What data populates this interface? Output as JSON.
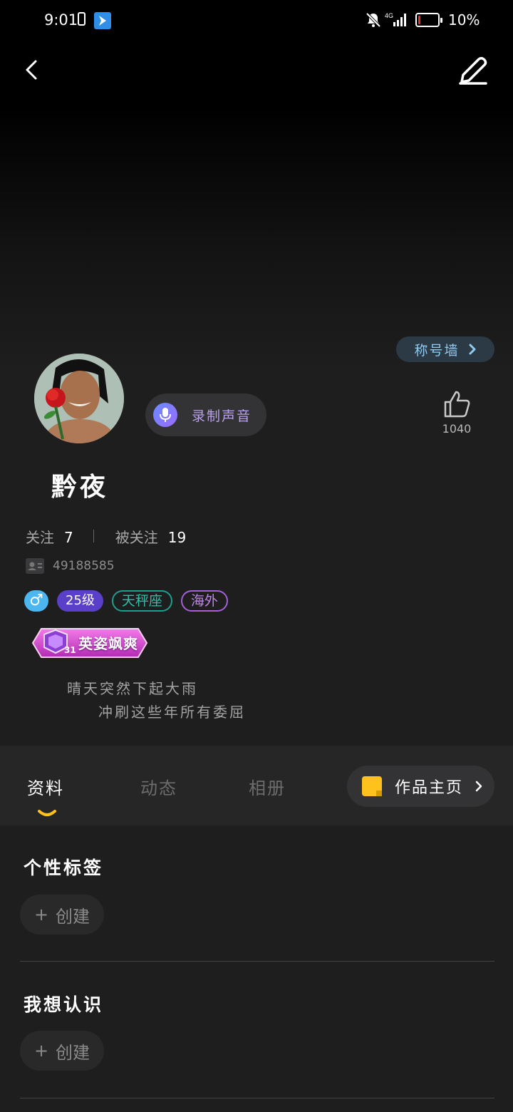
{
  "status_bar": {
    "time": "9:01",
    "network": "4G",
    "battery": "10%"
  },
  "profile": {
    "title_wall_label": "称号墙",
    "record_voice_label": "录制声音",
    "like_count": "1040",
    "nickname": "黔夜",
    "following_label": "关注",
    "following_count": "7",
    "followers_label": "被关注",
    "followers_count": "19",
    "user_id": "49188585",
    "gender_symbol": "♂",
    "level": "25级",
    "zodiac": "天秤座",
    "region": "海外",
    "medal_title": "英姿飒爽",
    "medal_level": "31",
    "bio_line1": "晴天突然下起大雨",
    "bio_line2": "冲刷这些年所有委屈"
  },
  "tabs": [
    {
      "label": "资料",
      "active": true
    },
    {
      "label": "动态",
      "active": false
    },
    {
      "label": "相册",
      "active": false
    }
  ],
  "works_button_label": "作品主页",
  "sections": [
    {
      "title": "个性标签",
      "create_label": "创建"
    },
    {
      "title": "我想认识",
      "create_label": "创建"
    }
  ],
  "colors": {
    "accent_yellow": "#ffc21c",
    "level_purple": "#5a3fc8",
    "zodiac_teal": "#2bc1a9",
    "region_purple": "#c184ee",
    "gender_blue": "#4bb6f0"
  }
}
